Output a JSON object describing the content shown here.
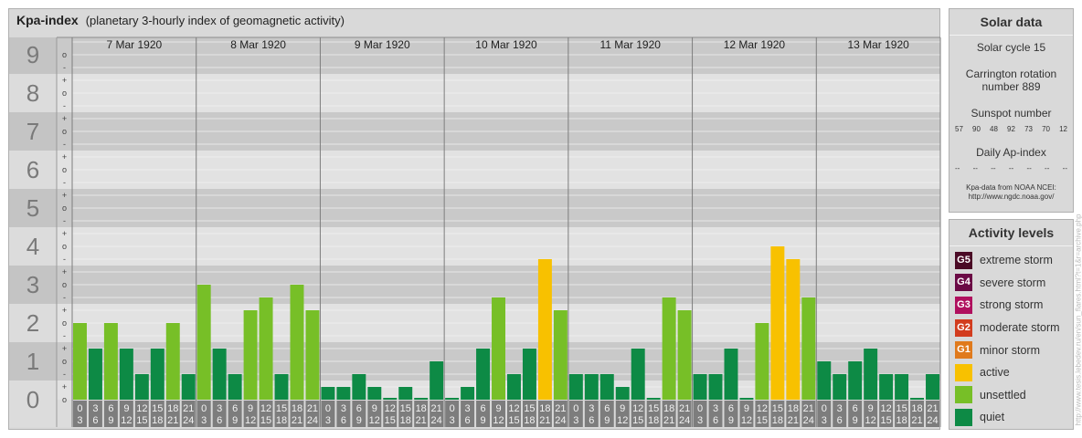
{
  "title": "Kpa-index",
  "subtitle": "(planetary 3-hourly index of geomagnetic activity)",
  "chart_data": {
    "type": "bar",
    "title": "Kpa-index",
    "subtitle": "(planetary 3-hourly index of geomagnetic activity)",
    "ylim": [
      0,
      9.67
    ],
    "y_ticks": [
      "0",
      "1",
      "2",
      "3",
      "4",
      "5",
      "6",
      "7",
      "8",
      "9"
    ],
    "y_minor_labels": [
      "o",
      "+",
      "-",
      "o",
      "+",
      "-",
      "o",
      "+",
      "-",
      "o",
      "+",
      "-",
      "o",
      "+",
      "-",
      "o",
      "+",
      "-",
      "o",
      "+",
      "-",
      "o",
      "+",
      "-",
      "o",
      "+",
      "-",
      "o"
    ],
    "days": [
      "7 Mar 1920",
      "8 Mar 1920",
      "9 Mar 1920",
      "10 Mar 1920",
      "11 Mar 1920",
      "12 Mar 1920",
      "13 Mar 1920"
    ],
    "interval_top": [
      "0",
      "3",
      "6",
      "9",
      "12",
      "15",
      "18",
      "21"
    ],
    "interval_bottom": [
      "3",
      "6",
      "9",
      "12",
      "15",
      "18",
      "21",
      "24"
    ],
    "values": [
      [
        2.0,
        1.333,
        2.0,
        1.333,
        0.667,
        1.333,
        2.0,
        0.667
      ],
      [
        3.0,
        1.333,
        0.667,
        2.333,
        2.667,
        0.667,
        3.0,
        2.333
      ],
      [
        0.333,
        0.333,
        0.667,
        0.333,
        0.0,
        0.333,
        0.0,
        1.0
      ],
      [
        0.0,
        0.333,
        1.333,
        2.667,
        0.667,
        1.333,
        3.667,
        2.333
      ],
      [
        0.667,
        0.667,
        0.667,
        0.333,
        1.333,
        0.0,
        2.667,
        2.333
      ],
      [
        0.667,
        0.667,
        1.333,
        0.0,
        2.0,
        4.0,
        3.667,
        2.667
      ],
      [
        1.0,
        0.667,
        1.0,
        1.333,
        0.667,
        0.667,
        0.0,
        0.667
      ]
    ],
    "colors": {
      "quiet": "#0d8a45",
      "unsettled": "#77bf27",
      "active": "#f8c100",
      "minor": "#e07a1c",
      "moderate": "#d23c1e",
      "strong": "#b0105e",
      "severe": "#6b0a45",
      "extreme": "#4a0a25"
    }
  },
  "solar": {
    "title": "Solar data",
    "cycle": "Solar cycle 15",
    "carrington_line1": "Carrington rotation",
    "carrington_line2": "number 889",
    "sunspot_label": "Sunspot number",
    "sunspot_values": [
      "57",
      "90",
      "48",
      "92",
      "73",
      "70",
      "12"
    ],
    "ap_label": "Daily Ap-index",
    "ap_values": [
      "--",
      "--",
      "--",
      "--",
      "--",
      "--",
      "--"
    ],
    "note_line1": "Kpa-data from NOAA NCEI:",
    "note_line2": "http://www.ngdc.noaa.gov/"
  },
  "activity": {
    "title": "Activity levels",
    "levels": [
      {
        "code": "G5",
        "label": "extreme storm",
        "color": "#4a0a25"
      },
      {
        "code": "G4",
        "label": "severe storm",
        "color": "#6b0a45"
      },
      {
        "code": "G3",
        "label": "strong storm",
        "color": "#b0105e"
      },
      {
        "code": "G2",
        "label": "moderate storm",
        "color": "#d23c1e"
      },
      {
        "code": "G1",
        "label": "minor storm",
        "color": "#e07a1c"
      },
      {
        "code": "",
        "label": "active",
        "color": "#f8c100"
      },
      {
        "code": "",
        "label": "unsettled",
        "color": "#77bf27"
      },
      {
        "code": "",
        "label": "quiet",
        "color": "#0d8a45"
      }
    ]
  },
  "watermark": "http://www.tesis.lebedev.ru/en/sun_flares.html?t=1&r=archive.php"
}
